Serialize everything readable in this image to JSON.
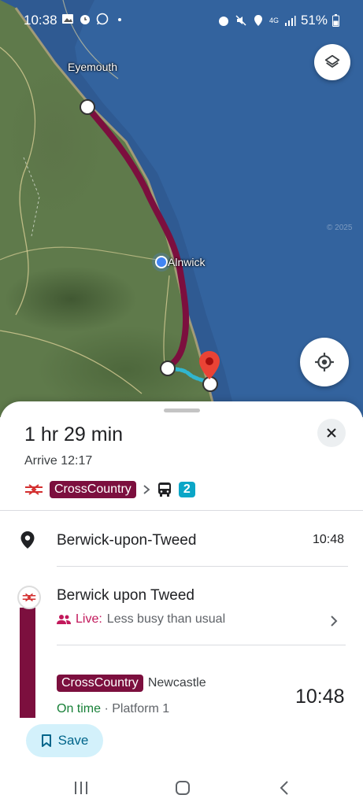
{
  "status_bar": {
    "time": "10:38",
    "battery": "51%",
    "signal_label": "4G"
  },
  "map": {
    "labels": {
      "town_north": "Eyemouth",
      "town_mid": "Alnwick"
    },
    "watermark": "© 2025"
  },
  "colors": {
    "train_route": "#7c0f3e",
    "walk_route": "#31b6cf",
    "accent": "#0ba6c7",
    "ontime": "#188038",
    "live": "#c2185b"
  },
  "trip": {
    "duration": "1 hr 29 min",
    "arrive": "Arrive 12:17",
    "operator_badge": "CrossCountry",
    "transfer_count": "2"
  },
  "origin": {
    "name": "Berwick-upon-Tweed",
    "time": "10:48"
  },
  "station": {
    "name": "Berwick upon Tweed",
    "live_label": "Live:",
    "live_text": "Less busy than usual"
  },
  "train": {
    "operator": "CrossCountry",
    "destination": "Newcastle",
    "status": "On time",
    "platform": "· Platform 1",
    "time": "10:48"
  },
  "actions": {
    "save_label": "Save"
  },
  "icons": {
    "layers": "layers-icon",
    "locate": "my-location-icon",
    "close": "close-icon",
    "rail": "national-rail-icon",
    "bus": "bus-icon",
    "pin": "place-pin-icon",
    "people": "people-icon",
    "bookmark": "bookmark-icon"
  }
}
